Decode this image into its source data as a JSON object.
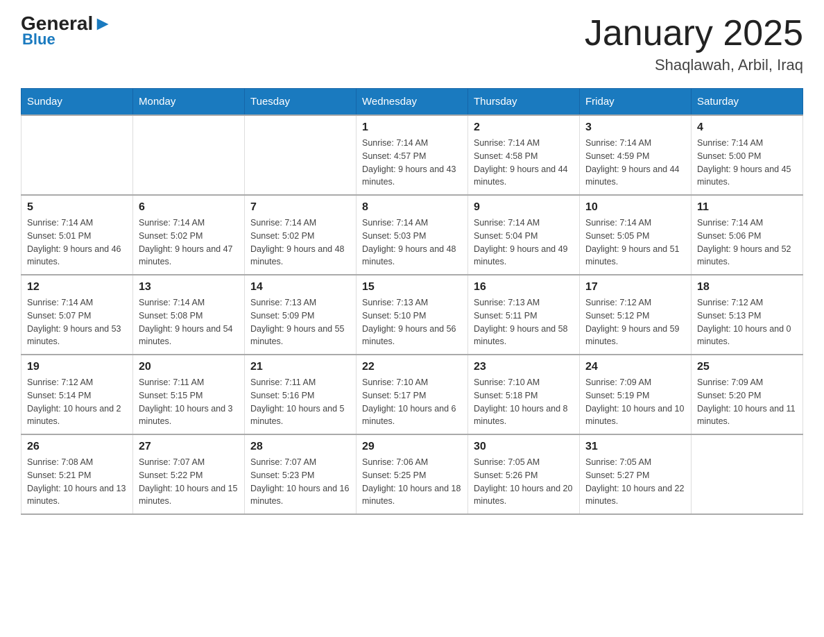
{
  "header": {
    "logo_general": "General",
    "logo_blue": "Blue",
    "main_title": "January 2025",
    "subtitle": "Shaqlawah, Arbil, Iraq"
  },
  "days_of_week": [
    "Sunday",
    "Monday",
    "Tuesday",
    "Wednesday",
    "Thursday",
    "Friday",
    "Saturday"
  ],
  "weeks": [
    [
      {
        "day": "",
        "info": ""
      },
      {
        "day": "",
        "info": ""
      },
      {
        "day": "",
        "info": ""
      },
      {
        "day": "1",
        "info": "Sunrise: 7:14 AM\nSunset: 4:57 PM\nDaylight: 9 hours and 43 minutes."
      },
      {
        "day": "2",
        "info": "Sunrise: 7:14 AM\nSunset: 4:58 PM\nDaylight: 9 hours and 44 minutes."
      },
      {
        "day": "3",
        "info": "Sunrise: 7:14 AM\nSunset: 4:59 PM\nDaylight: 9 hours and 44 minutes."
      },
      {
        "day": "4",
        "info": "Sunrise: 7:14 AM\nSunset: 5:00 PM\nDaylight: 9 hours and 45 minutes."
      }
    ],
    [
      {
        "day": "5",
        "info": "Sunrise: 7:14 AM\nSunset: 5:01 PM\nDaylight: 9 hours and 46 minutes."
      },
      {
        "day": "6",
        "info": "Sunrise: 7:14 AM\nSunset: 5:02 PM\nDaylight: 9 hours and 47 minutes."
      },
      {
        "day": "7",
        "info": "Sunrise: 7:14 AM\nSunset: 5:02 PM\nDaylight: 9 hours and 48 minutes."
      },
      {
        "day": "8",
        "info": "Sunrise: 7:14 AM\nSunset: 5:03 PM\nDaylight: 9 hours and 48 minutes."
      },
      {
        "day": "9",
        "info": "Sunrise: 7:14 AM\nSunset: 5:04 PM\nDaylight: 9 hours and 49 minutes."
      },
      {
        "day": "10",
        "info": "Sunrise: 7:14 AM\nSunset: 5:05 PM\nDaylight: 9 hours and 51 minutes."
      },
      {
        "day": "11",
        "info": "Sunrise: 7:14 AM\nSunset: 5:06 PM\nDaylight: 9 hours and 52 minutes."
      }
    ],
    [
      {
        "day": "12",
        "info": "Sunrise: 7:14 AM\nSunset: 5:07 PM\nDaylight: 9 hours and 53 minutes."
      },
      {
        "day": "13",
        "info": "Sunrise: 7:14 AM\nSunset: 5:08 PM\nDaylight: 9 hours and 54 minutes."
      },
      {
        "day": "14",
        "info": "Sunrise: 7:13 AM\nSunset: 5:09 PM\nDaylight: 9 hours and 55 minutes."
      },
      {
        "day": "15",
        "info": "Sunrise: 7:13 AM\nSunset: 5:10 PM\nDaylight: 9 hours and 56 minutes."
      },
      {
        "day": "16",
        "info": "Sunrise: 7:13 AM\nSunset: 5:11 PM\nDaylight: 9 hours and 58 minutes."
      },
      {
        "day": "17",
        "info": "Sunrise: 7:12 AM\nSunset: 5:12 PM\nDaylight: 9 hours and 59 minutes."
      },
      {
        "day": "18",
        "info": "Sunrise: 7:12 AM\nSunset: 5:13 PM\nDaylight: 10 hours and 0 minutes."
      }
    ],
    [
      {
        "day": "19",
        "info": "Sunrise: 7:12 AM\nSunset: 5:14 PM\nDaylight: 10 hours and 2 minutes."
      },
      {
        "day": "20",
        "info": "Sunrise: 7:11 AM\nSunset: 5:15 PM\nDaylight: 10 hours and 3 minutes."
      },
      {
        "day": "21",
        "info": "Sunrise: 7:11 AM\nSunset: 5:16 PM\nDaylight: 10 hours and 5 minutes."
      },
      {
        "day": "22",
        "info": "Sunrise: 7:10 AM\nSunset: 5:17 PM\nDaylight: 10 hours and 6 minutes."
      },
      {
        "day": "23",
        "info": "Sunrise: 7:10 AM\nSunset: 5:18 PM\nDaylight: 10 hours and 8 minutes."
      },
      {
        "day": "24",
        "info": "Sunrise: 7:09 AM\nSunset: 5:19 PM\nDaylight: 10 hours and 10 minutes."
      },
      {
        "day": "25",
        "info": "Sunrise: 7:09 AM\nSunset: 5:20 PM\nDaylight: 10 hours and 11 minutes."
      }
    ],
    [
      {
        "day": "26",
        "info": "Sunrise: 7:08 AM\nSunset: 5:21 PM\nDaylight: 10 hours and 13 minutes."
      },
      {
        "day": "27",
        "info": "Sunrise: 7:07 AM\nSunset: 5:22 PM\nDaylight: 10 hours and 15 minutes."
      },
      {
        "day": "28",
        "info": "Sunrise: 7:07 AM\nSunset: 5:23 PM\nDaylight: 10 hours and 16 minutes."
      },
      {
        "day": "29",
        "info": "Sunrise: 7:06 AM\nSunset: 5:25 PM\nDaylight: 10 hours and 18 minutes."
      },
      {
        "day": "30",
        "info": "Sunrise: 7:05 AM\nSunset: 5:26 PM\nDaylight: 10 hours and 20 minutes."
      },
      {
        "day": "31",
        "info": "Sunrise: 7:05 AM\nSunset: 5:27 PM\nDaylight: 10 hours and 22 minutes."
      },
      {
        "day": "",
        "info": ""
      }
    ]
  ]
}
